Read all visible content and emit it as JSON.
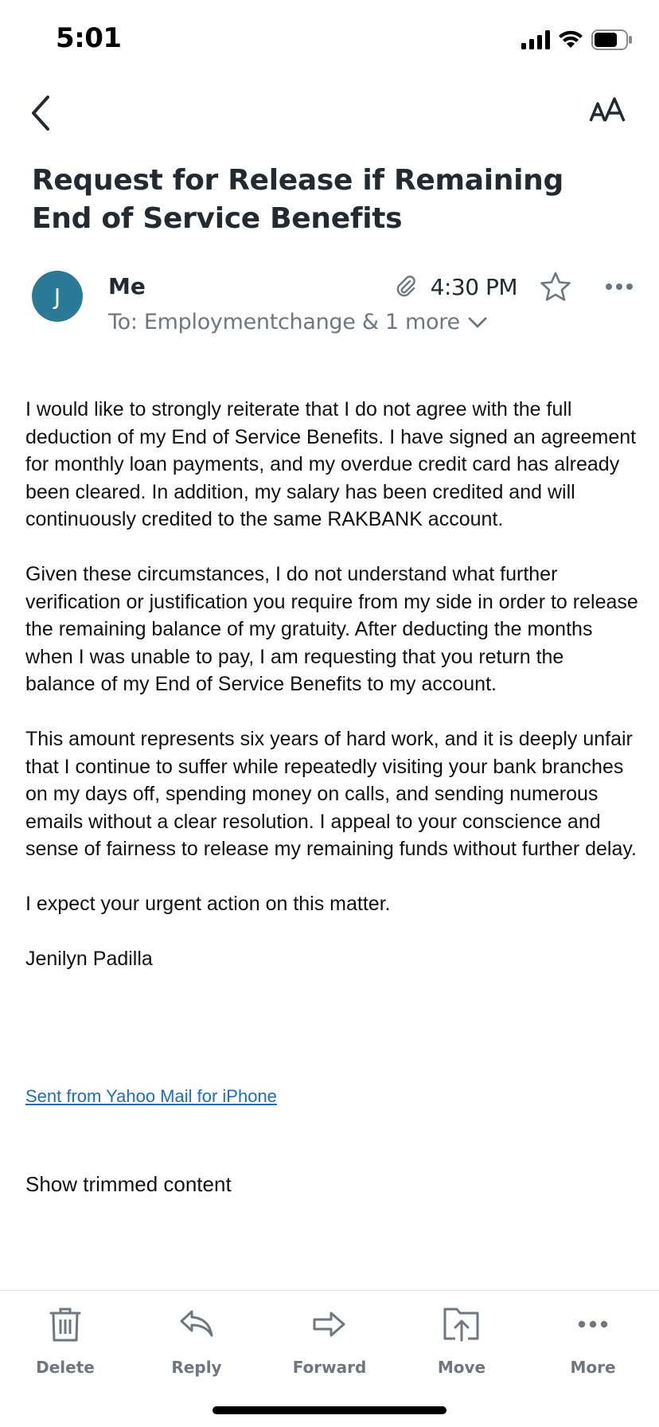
{
  "status_bar": {
    "time": "5:01"
  },
  "email": {
    "subject": "Request for Release if Remaining End of Service Benefits",
    "avatar_initial": "J",
    "sender": "Me",
    "recipients": "To: Employmentchange & 1 more",
    "time": "4:30 PM",
    "body": [
      "I would like to strongly reiterate that I do not agree with the full deduction of my End of Service Benefits. I have signed an agreement for monthly loan payments, and my overdue credit card has already been cleared. In addition, my salary has been credited and will continuously credited to the same RAKBANK account.",
      "Given these circumstances, I do not understand what further verification or justification you require from my side in order to release the remaining balance of my gratuity. After deducting the months when I was unable to pay, I am requesting that you return the balance of my End of Service Benefits to my account.",
      "This amount represents six years of hard work, and it is deeply unfair that I continue to suffer while repeatedly visiting your bank branches on my days off, spending money on calls, and sending numerous emails without a clear resolution. I appeal to your conscience and sense of fairness to release my remaining funds without further delay.",
      "I expect your urgent action on this matter.",
      "Jenilyn Padilla"
    ],
    "signature_link": "Sent from Yahoo Mail for iPhone",
    "show_trimmed": "Show trimmed content"
  },
  "toolbar": {
    "delete": "Delete",
    "reply": "Reply",
    "forward": "Forward",
    "move": "Move",
    "more": "More"
  },
  "colors": {
    "avatar": "#2a7a97",
    "link": "#1a6fc4",
    "muted": "#6e7780",
    "heading": "#232a31"
  },
  "icons": [
    "back-chevron-icon",
    "text-size-icon",
    "paperclip-icon",
    "star-icon",
    "more-dots-icon",
    "chevron-down-icon",
    "trash-icon",
    "reply-icon",
    "forward-icon",
    "move-icon"
  ]
}
